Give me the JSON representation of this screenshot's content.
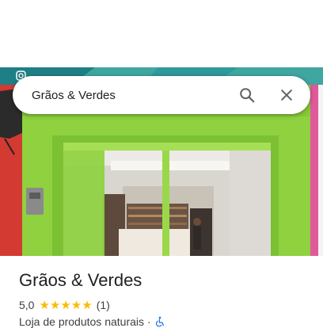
{
  "search": {
    "query": "Grãos & Verdes"
  },
  "place": {
    "name": "Grãos & Verdes",
    "rating": "5,0",
    "stars": "★★★★★",
    "review_count": "(1)",
    "category": "Loja de produtos naturais",
    "separator": "·"
  },
  "colors": {
    "star": "#fbbc04",
    "facade_green": "#8fd13f",
    "text_primary": "#202124",
    "text_secondary": "#3c4043"
  },
  "icons": [
    "search-icon",
    "close-icon",
    "wheelchair-accessible-icon",
    "instagram-icon"
  ]
}
